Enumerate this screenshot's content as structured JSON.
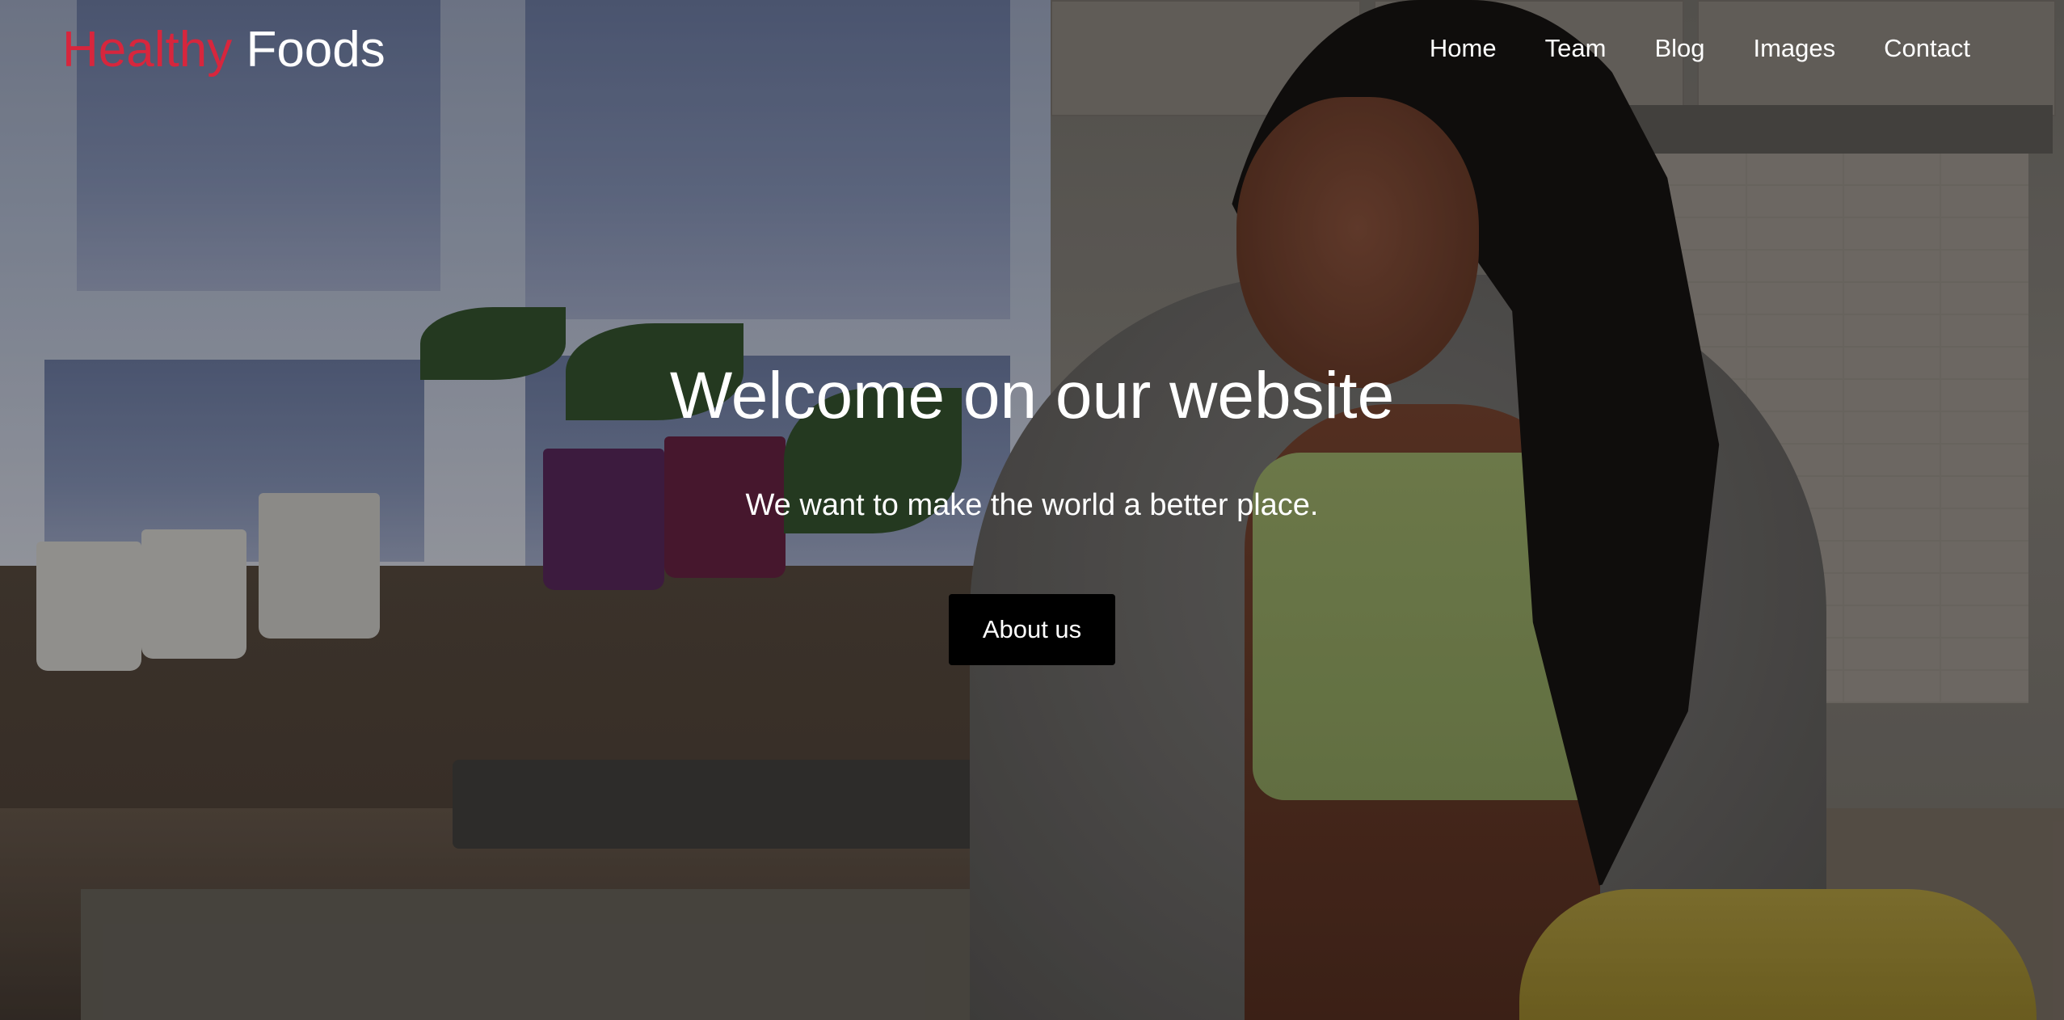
{
  "brand": {
    "accent_word": "Healthy",
    "rest_word": "Foods",
    "accent_color": "#d7263d"
  },
  "nav": {
    "items": [
      {
        "label": "Home"
      },
      {
        "label": "Team"
      },
      {
        "label": "Blog"
      },
      {
        "label": "Images"
      },
      {
        "label": "Contact"
      }
    ]
  },
  "hero": {
    "title": "Welcome on our website",
    "subtitle": "We want to make the world a better place.",
    "cta_label": "About us"
  }
}
